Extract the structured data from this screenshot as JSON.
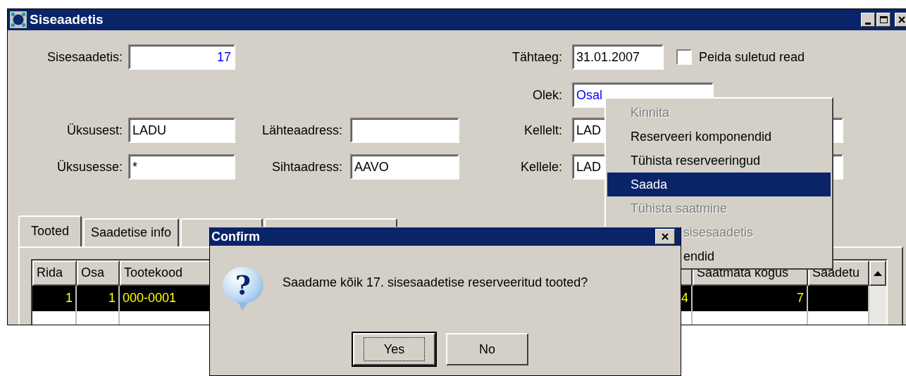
{
  "window": {
    "title": "Siseaadetis"
  },
  "form": {
    "document": {
      "label": "Sisesaadetis:",
      "value": "17"
    },
    "from_unit": {
      "label": "Üksusest:",
      "value": "LADU"
    },
    "to_unit": {
      "label": "Üksusesse:",
      "value": "*"
    },
    "source_address": {
      "label": "Lähteaadress:"
    },
    "target_address": {
      "label": "Sihtaadress:",
      "value": "AAVO"
    },
    "due_date": {
      "label": "Tähtaeg:",
      "value": "31.01.2007"
    },
    "hide_closed": {
      "label": "Peida suletud read",
      "checked": false
    },
    "status": {
      "label": "Olek:",
      "value": "Osal"
    },
    "sender": {
      "label": "Kellelt:",
      "value": "LAD"
    },
    "recipient": {
      "label": "Kellele:",
      "value": "LAD"
    }
  },
  "tabs": [
    {
      "label": "Tooted",
      "selected": true
    },
    {
      "label": "Saadetise info",
      "selected": false
    },
    {
      "selected": false
    },
    {
      "selected": false
    }
  ],
  "table": {
    "columns": [
      {
        "label": "Rida"
      },
      {
        "label": "Osa"
      },
      {
        "label": "Tootekood"
      },
      {},
      {
        "label": "Saatmata kogus"
      },
      {
        "label": "Saadetu"
      }
    ],
    "rows": [
      {
        "selected": true,
        "cells": [
          "1",
          "1",
          "000-0001",
          "4",
          "7"
        ]
      }
    ]
  },
  "context_menu": {
    "items": [
      {
        "label": "Kinnita",
        "kind": "full",
        "disabled": true,
        "selected": false
      },
      {
        "label": "Reserveeri komponendid",
        "kind": "full",
        "disabled": false,
        "selected": false
      },
      {
        "label": "Tühista reserveeringud",
        "kind": "full",
        "disabled": false,
        "selected": false
      },
      {
        "label": "Saada",
        "kind": "full",
        "disabled": false,
        "selected": true
      },
      {
        "label": "Tühista saatmine",
        "kind": "full",
        "disabled": true,
        "selected": false
      },
      {
        "label": "sisesaadetis",
        "kind": "partial",
        "disabled": true,
        "selected": false
      },
      {
        "label": "endid",
        "kind": "partial",
        "disabled": false,
        "selected": false
      }
    ]
  },
  "dialog": {
    "title": "Confirm",
    "icon": "?",
    "message": "Saadame kõik 17. sisesaadetise reserveeritud tooted?",
    "buttons": [
      {
        "label": "Yes",
        "focused": true
      },
      {
        "label": "No",
        "focused": false
      }
    ]
  }
}
